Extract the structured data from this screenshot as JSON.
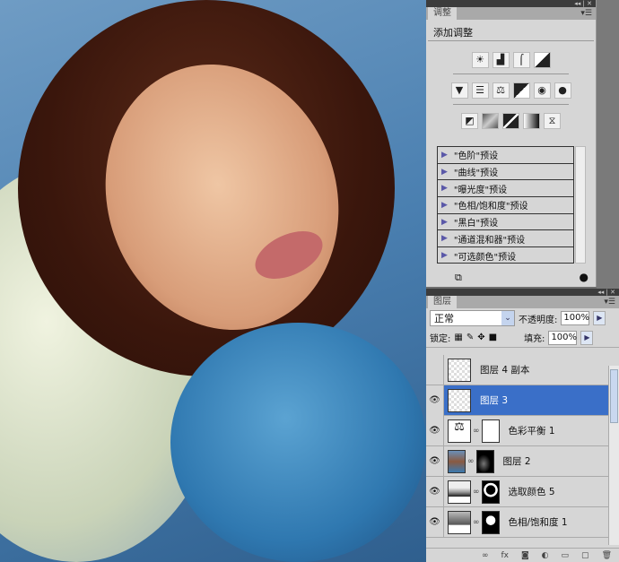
{
  "adjustments": {
    "tab": "调整",
    "heading": "添加调整",
    "presets": [
      "\"色阶\"预设",
      "\"曲线\"预设",
      "\"曝光度\"预设",
      "\"色相/饱和度\"预设",
      "\"黑白\"预设",
      "\"通道混和器\"预设",
      "\"可选颜色\"预设"
    ]
  },
  "layers": {
    "tab": "图层",
    "blend_mode": "正常",
    "opacity_label": "不透明度:",
    "opacity": "100%",
    "lock_label": "锁定:",
    "fill_label": "填充:",
    "fill": "100%",
    "items": [
      {
        "name": "图层 4 副本",
        "visible": false,
        "selected": false
      },
      {
        "name": "图层 3",
        "visible": true,
        "selected": true
      },
      {
        "name": "色彩平衡 1",
        "visible": true,
        "selected": false
      },
      {
        "name": "图层 2",
        "visible": true,
        "selected": false
      },
      {
        "name": "选取颜色 5",
        "visible": true,
        "selected": false
      },
      {
        "name": "色相/饱和度 1",
        "visible": true,
        "selected": false
      }
    ]
  },
  "colors": {
    "selected": "#3a6fc8",
    "panel": "#d6d6d6"
  }
}
